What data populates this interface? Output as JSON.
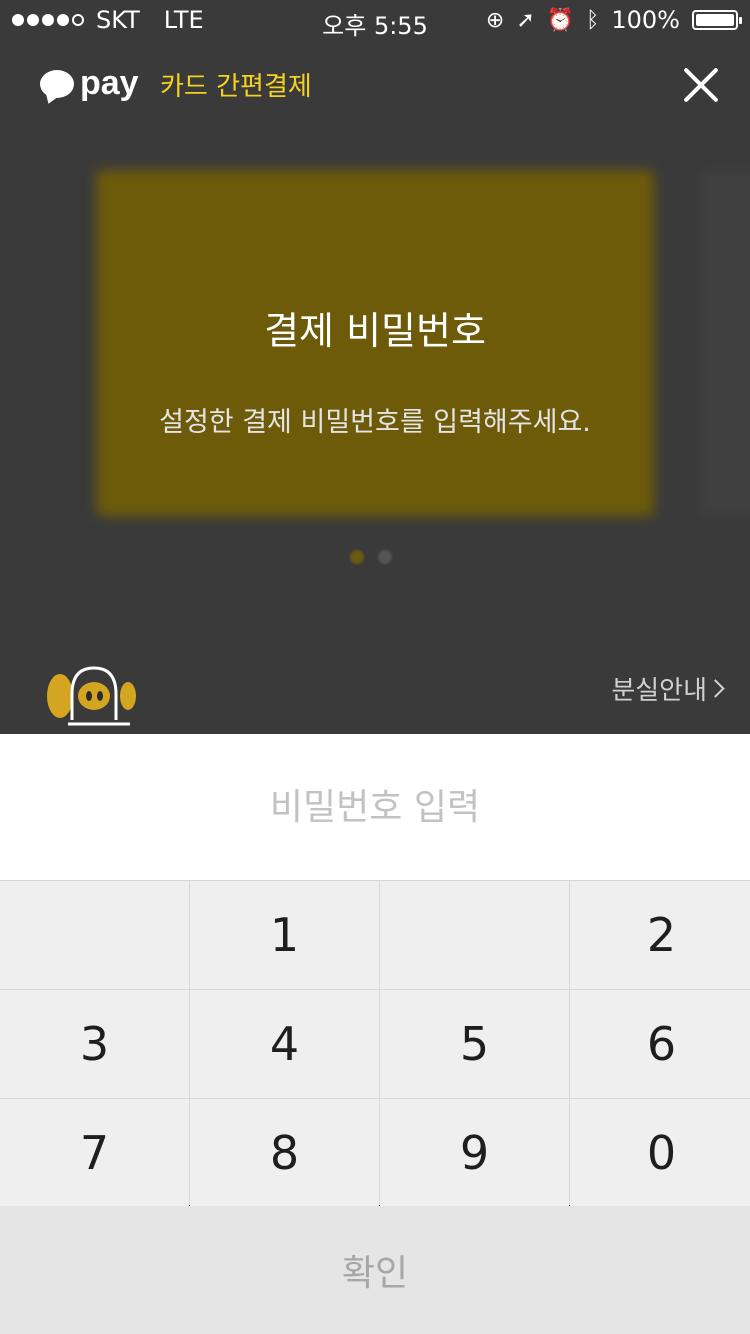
{
  "status_bar": {
    "carrier": "SKT",
    "network": "LTE",
    "time": "오후 5:55",
    "battery": "100%",
    "signal_bars_filled": 4,
    "signal_bars_total": 5
  },
  "header": {
    "logo_text": "pay",
    "title": "카드 간편결제"
  },
  "dialog": {
    "title": "결제 비밀번호",
    "subtitle": "설정한 결제 비밀번호를 입력해주세요."
  },
  "lost_link": "분실안내",
  "input": {
    "placeholder": "비밀번호 입력",
    "value": ""
  },
  "keypad": {
    "keys": [
      "",
      "1",
      "",
      "2",
      "3",
      "4",
      "5",
      "6",
      "7",
      "8",
      "9",
      "0"
    ]
  },
  "confirm_label": "확인",
  "colors": {
    "accent": "#f5d21f",
    "overlay": "#3a3a3a",
    "keypad_bg": "#efefef"
  },
  "icons": {
    "logo": "speech-bubble-icon",
    "close": "close-icon",
    "character": "character-icon",
    "chevron": "chevron-right-icon"
  }
}
